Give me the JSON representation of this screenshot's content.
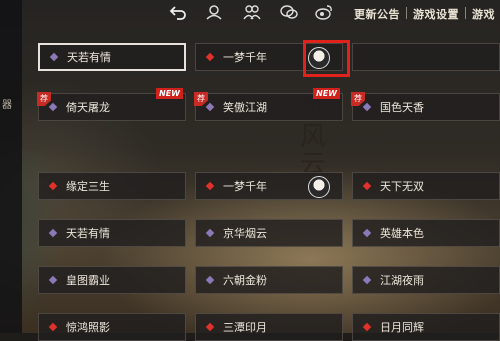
{
  "topbar": {
    "menu": [
      "更新公告",
      "游戏设置",
      "游戏"
    ],
    "icons": [
      "back-icon",
      "account-icon",
      "friends-icon",
      "chat-icon",
      "weibo-icon"
    ]
  },
  "leftnav": {
    "glyph": "器"
  },
  "calligraphy": "剑风云",
  "colors": {
    "selected_border": "#e7e3dc",
    "highlight_box": "#e0221d",
    "recommend_tag": "#c82a24",
    "purple_diamond": "#8d78b8",
    "red_diamond": "#e0322a"
  },
  "servers": [
    {
      "name": "天若有情",
      "marker": "purple",
      "selected": true
    },
    {
      "name": "一梦千年",
      "marker": "red",
      "avatar": true
    },
    {
      "name": "",
      "marker": "none"
    },
    {
      "name": "倚天屠龙",
      "marker": "purple",
      "recommend": "荐",
      "new": "NEW"
    },
    {
      "name": "笑傲江湖",
      "marker": "purple",
      "recommend": "荐",
      "new": "NEW"
    },
    {
      "name": "国色天香",
      "marker": "purple",
      "recommend": "荐"
    },
    {
      "name": "缘定三生",
      "marker": "red"
    },
    {
      "name": "一梦千年",
      "marker": "red",
      "avatar": true
    },
    {
      "name": "天下无双",
      "marker": "red"
    },
    {
      "name": "天若有情",
      "marker": "purple"
    },
    {
      "name": "京华烟云",
      "marker": "purple"
    },
    {
      "name": "英雄本色",
      "marker": "purple"
    },
    {
      "name": "皇图霸业",
      "marker": "purple"
    },
    {
      "name": "六朝金粉",
      "marker": "purple"
    },
    {
      "name": "江湖夜雨",
      "marker": "purple"
    },
    {
      "name": "惊鸿照影",
      "marker": "red"
    },
    {
      "name": "三潭印月",
      "marker": "red"
    },
    {
      "name": "日月同辉",
      "marker": "red"
    }
  ]
}
